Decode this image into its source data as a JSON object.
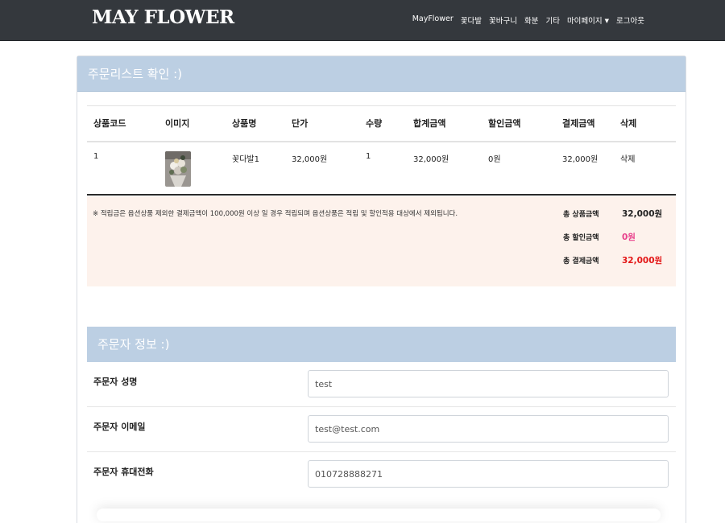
{
  "navbar": {
    "brand": "MAY FLOWER",
    "items": [
      "MayFlower",
      "꽃다발",
      "꽃바구니",
      "화분",
      "기타",
      "마이페이지",
      "로그아웃"
    ]
  },
  "order_panel": {
    "title": "주문리스트 확인 :)",
    "columns": [
      "상품코드",
      "이미지",
      "상품명",
      "단가",
      "수량",
      "합계금액",
      "할인금액",
      "결제금액",
      "삭제"
    ],
    "rows": [
      {
        "code": "1",
        "image": "bouquet-thumbnail",
        "name": "꽃다발1",
        "unit_price": "32,000원",
        "qty": "1",
        "total": "32,000원",
        "discount": "0원",
        "payment": "32,000원",
        "delete": "삭제"
      }
    ]
  },
  "summary": {
    "note": "※ 적립금은 옵션상품 제외한 결제금액이 100,000원 이상 일 경우 적립되며 옵션상품은 적립 및 할인적용 대상에서 제외됩니다.",
    "product_label": "총 상품금액",
    "product_value": "32,000원",
    "discount_label": "총 할인금액",
    "discount_value": "0원",
    "payment_label": "총 결제금액",
    "payment_value": "32,000원",
    "colors": {
      "discount": "#e8418c",
      "payment": "#e31616"
    }
  },
  "orderer": {
    "title": "주문자 정보 :)",
    "name_label": "주문자 성명",
    "name_value": "test",
    "email_label": "주문자 이메일",
    "email_value": "test@test.com",
    "phone_label": "주문자 휴대전화",
    "phone_value": "010728888271"
  }
}
